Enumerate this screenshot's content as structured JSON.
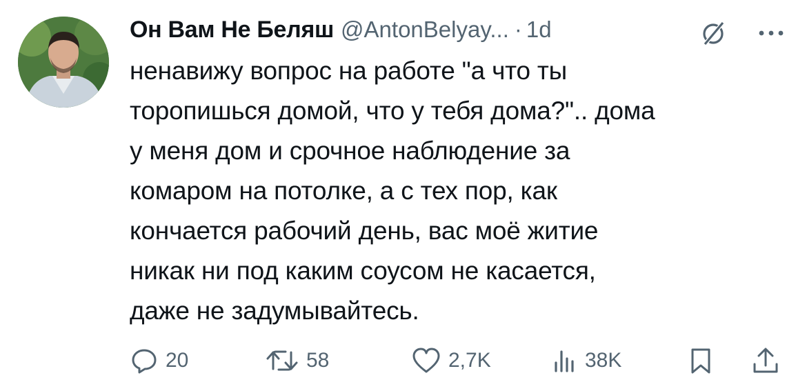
{
  "author": {
    "display_name": "Он Вам Не Беляш",
    "handle": "@AntonBelyay...",
    "separator": "·",
    "time": "1d",
    "avatar_icon": "avatar-photo"
  },
  "tweet": {
    "lines": [
      "ненавижу вопрос на работе \"а что ты",
      "торопишься домой, что у тебя дома?\".. дома",
      "у меня дом и срочное наблюдение за",
      "комаром на потолке, а с тех пор, как",
      "кончается рабочий день, вас моё житие",
      "никак ни под каким соусом не касается,",
      "даже не задумывайтесь."
    ]
  },
  "actions": {
    "replies": "20",
    "retweets": "58",
    "likes": "2,7K",
    "views": "38K"
  },
  "icons": {
    "grok": "grok-icon",
    "more": "more-icon",
    "reply": "reply-icon",
    "retweet": "retweet-icon",
    "like": "heart-icon",
    "views": "views-icon",
    "bookmark": "bookmark-icon",
    "share": "share-icon"
  },
  "colors": {
    "text_primary": "#0f1419",
    "text_secondary": "#536471",
    "background": "#ffffff"
  }
}
